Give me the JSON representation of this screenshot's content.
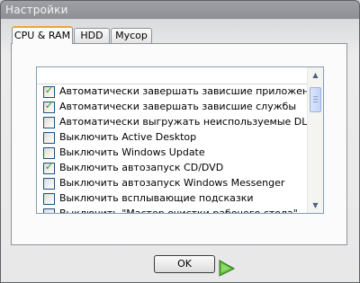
{
  "window": {
    "title": "Настройки"
  },
  "tabs": [
    {
      "label": "CPU & RAM",
      "active": true
    },
    {
      "label": "HDD",
      "active": false
    },
    {
      "label": "Мусор",
      "active": false
    }
  ],
  "options": [
    {
      "label": "Автоматически завершать зависшие приложения",
      "checked": true
    },
    {
      "label": "Автоматически завершать зависшие службы",
      "checked": true
    },
    {
      "label": "Автоматически выгружать неиспользуемые DLL и...",
      "checked": false
    },
    {
      "label": "Выключить Active Desktop",
      "checked": false
    },
    {
      "label": "Выключить Windows Update",
      "checked": false
    },
    {
      "label": "Выключить автозапуск CD/DVD",
      "checked": true
    },
    {
      "label": "Выключить автозапуск Windows Messenger",
      "checked": false
    },
    {
      "label": "Выключить всплывающие подсказки",
      "checked": false
    },
    {
      "label": "Выключить \"Мастер очистки рабочего стола\"",
      "checked": false
    }
  ],
  "ok_label": "OK",
  "colors": {
    "check": "#21a121",
    "tab_highlight": "#e8a73a",
    "title_bar": "#8d8f94"
  },
  "icons": {
    "scroll_up": "▲",
    "scroll_down": "▼",
    "check": "✓"
  }
}
